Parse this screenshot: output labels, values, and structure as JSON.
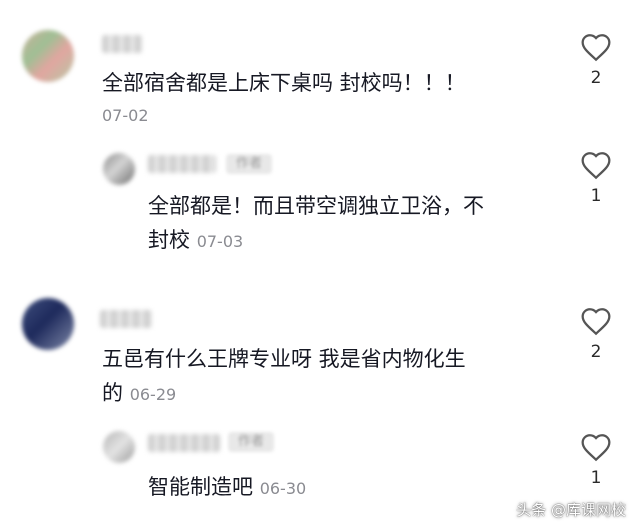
{
  "comments": [
    {
      "text": "全部宿舍都是上床下桌吗 封校吗！！！",
      "date": "07-02",
      "likes": "2"
    },
    {
      "text_line1": "全部都是！而且带空调独立卫浴，不",
      "text_line2": "封校",
      "date": "07-03",
      "likes": "1",
      "author_tag": "作者"
    },
    {
      "text_line1": "五邑有什么王牌专业呀 我是省内物化生",
      "text_line2": "的",
      "date": "06-29",
      "likes": "2"
    },
    {
      "text": "智能制造吧",
      "date": "06-30",
      "likes": "1",
      "author_tag": "作者"
    }
  ],
  "watermark": "头条 @库课网校",
  "icons": {
    "like": "heart-outline-icon"
  }
}
